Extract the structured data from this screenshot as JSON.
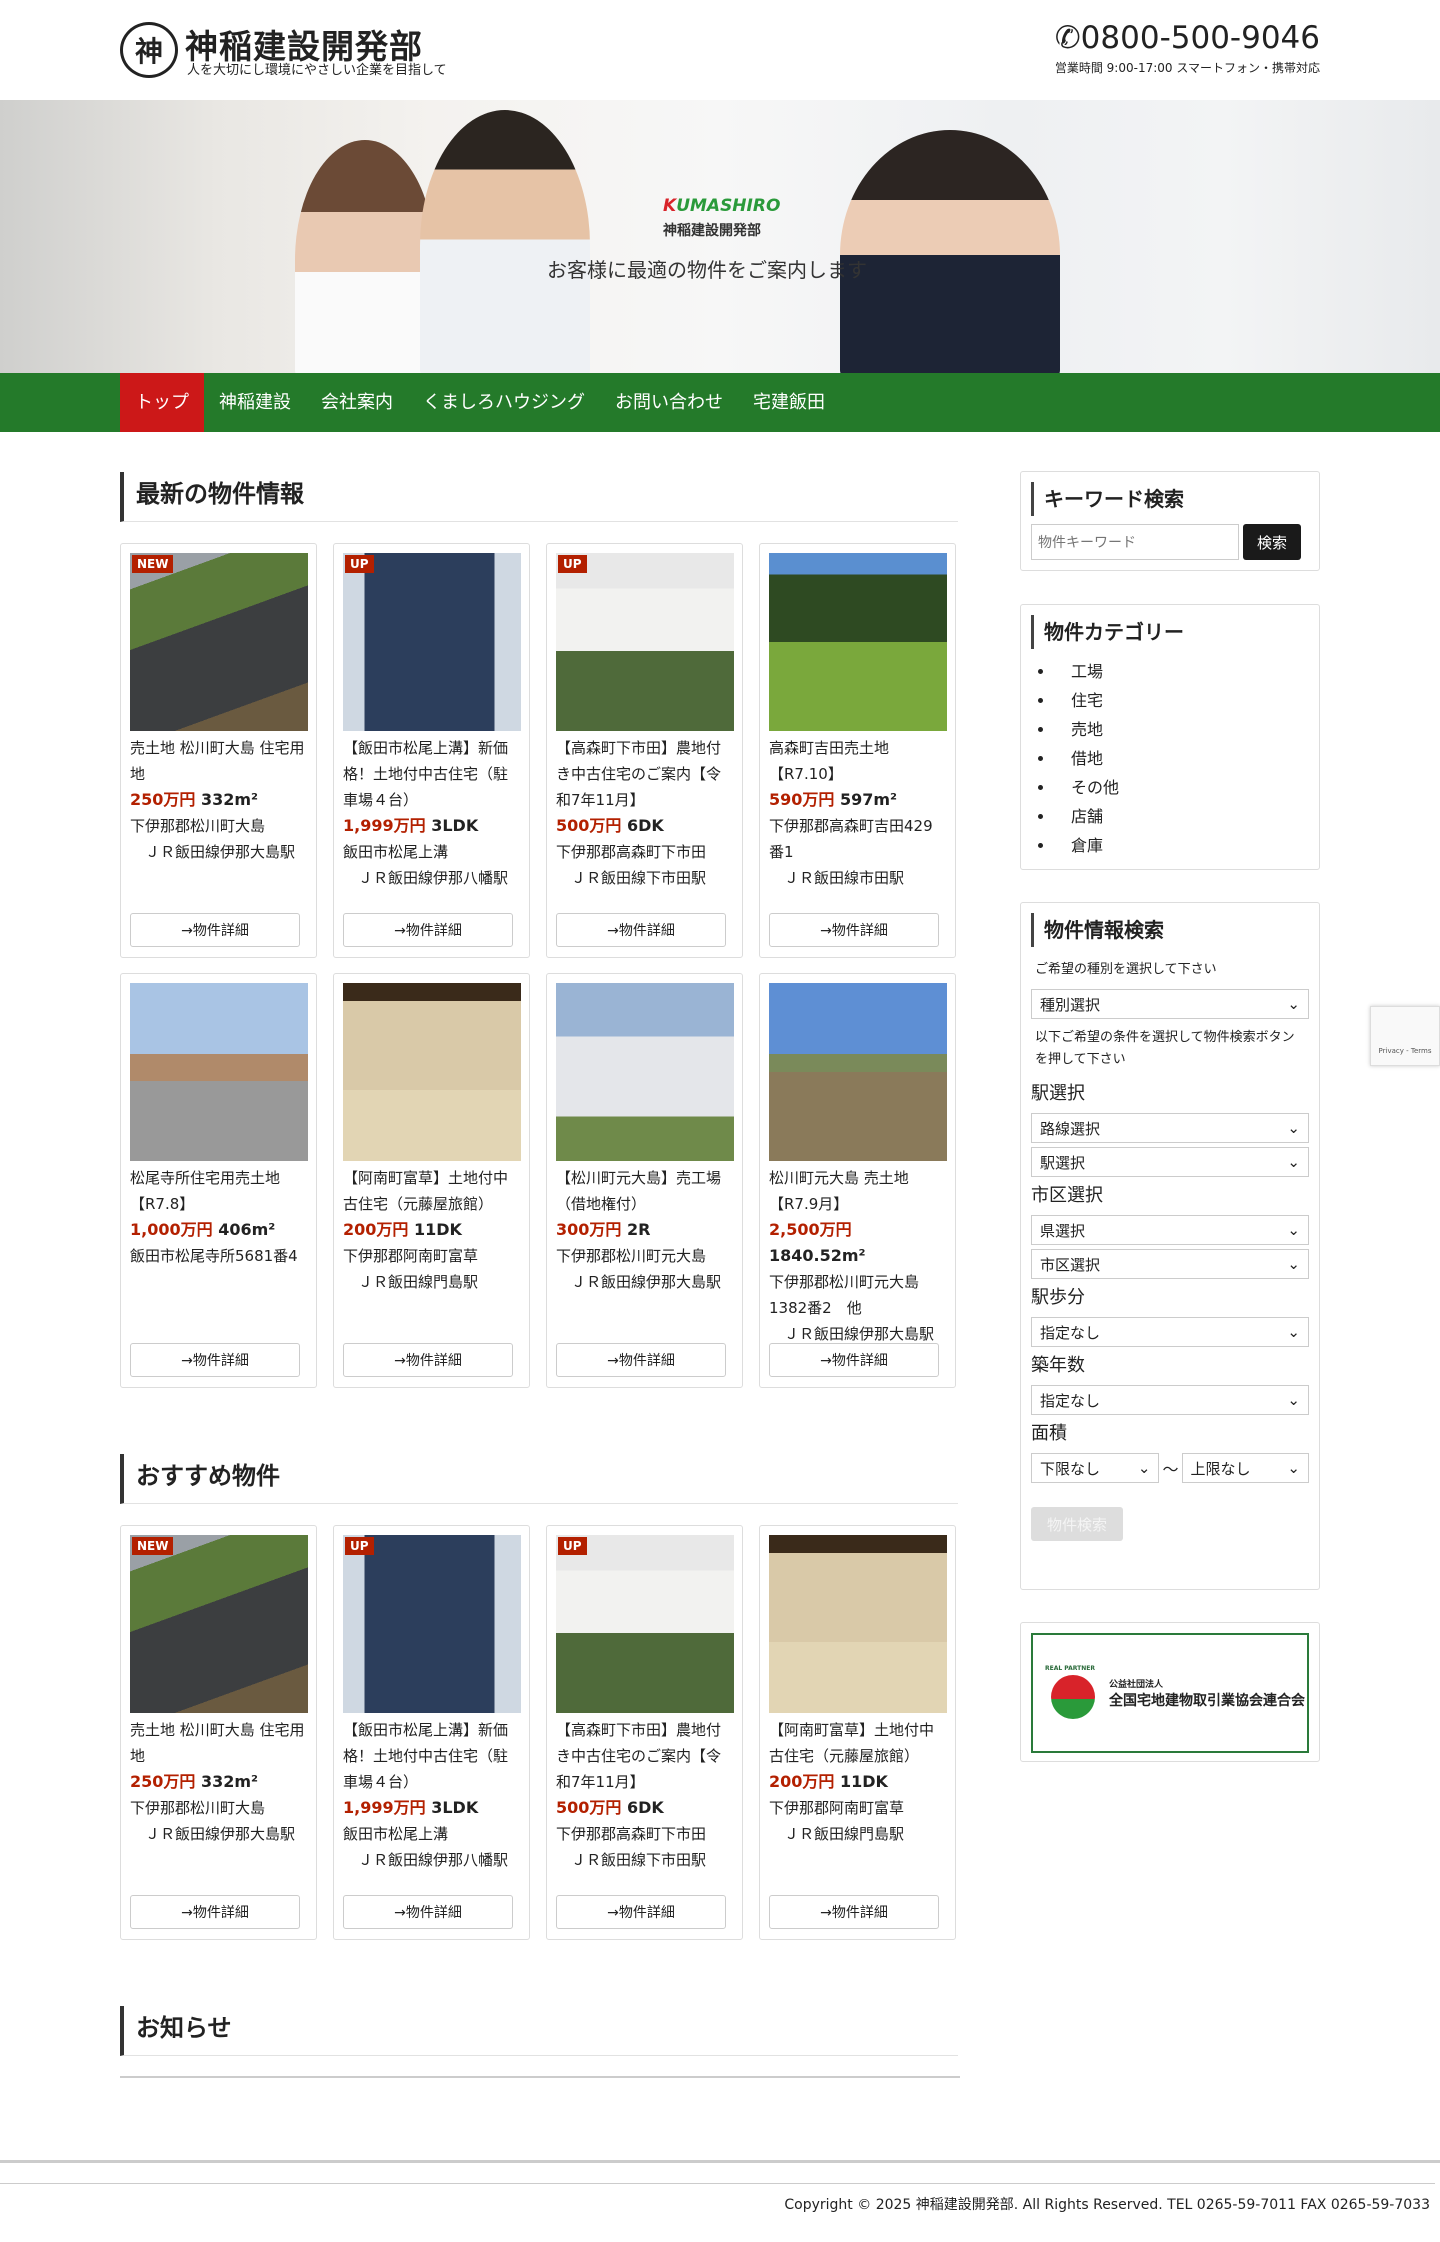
{
  "header": {
    "logo_char": "神",
    "title": "神稲建設開発部",
    "tagline": "人を大切にし環境にやさしい企業を目指して",
    "phone": "0800-500-9046",
    "hours": "営業時間 9:00-17:00 スマートフォン・携帯対応"
  },
  "hero": {
    "brand_k": "K",
    "brand_rest": "UMASHIRO",
    "sub": "神稲建設開発部",
    "copy": "お客様に最適の物件をご案内します"
  },
  "nav": [
    "トップ",
    "神稲建設",
    "会社案内",
    "くましろハウジング",
    "お問い合わせ",
    "宅建飯田"
  ],
  "sections": {
    "latest": "最新の物件情報",
    "recommended": "おすすめ物件",
    "news": "お知らせ"
  },
  "detail_label": "→物件詳細",
  "latest": [
    {
      "badge": "NEW",
      "image": "land-garden",
      "title": "売土地 松川町大島 住宅用地",
      "price": "250万円",
      "spec": "332m²",
      "address": "下伊那郡松川町大島",
      "station": "ＪＲ飯田線伊那大島駅"
    },
    {
      "badge": "UP",
      "image": "blue-house",
      "title": "【飯田市松尾上溝】新価格！土地付中古住宅（駐車場４台）",
      "price": "1,999万円",
      "spec": "3LDK",
      "address": "飯田市松尾上溝",
      "station": "ＪＲ飯田線伊那八幡駅"
    },
    {
      "badge": "UP",
      "image": "white-house",
      "title": "【高森町下市田】農地付き中古住宅のご案内【令和7年11月】",
      "price": "500万円",
      "spec": "6DK",
      "address": "下伊那郡高森町下市田",
      "station": "ＪＲ飯田線下市田駅"
    },
    {
      "badge": "",
      "image": "grass-field",
      "title": "高森町吉田売土地【R7.10】",
      "price": "590万円",
      "spec": "597m²",
      "address": "下伊那郡高森町吉田429番1",
      "station": "ＪＲ飯田線市田駅"
    },
    {
      "badge": "",
      "image": "street",
      "title": "松尾寺所住宅用売土地【R7.8】",
      "price": "1,000万円",
      "spec": "406m²",
      "address": "飯田市松尾寺所5681番4",
      "station": ""
    },
    {
      "badge": "",
      "image": "tatami-room",
      "title": "【阿南町富草】土地付中古住宅（元藤屋旅館）",
      "price": "200万円",
      "spec": "11DK",
      "address": "下伊那郡阿南町富草",
      "station": "ＪＲ飯田線門島駅"
    },
    {
      "badge": "",
      "image": "factory",
      "title": "【松川町元大島】売工場（借地権付）",
      "price": "300万円",
      "spec": "2R",
      "address": "下伊那郡松川町元大島",
      "station": "ＪＲ飯田線伊那大島駅"
    },
    {
      "badge": "",
      "image": "field-sky",
      "title": "松川町元大島 売土地【R7.9月】",
      "price": "2,500万円",
      "spec": "1840.52m²",
      "address": "下伊那郡松川町元大島1382番2　他",
      "station": "ＪＲ飯田線伊那大島駅"
    }
  ],
  "recommended": [
    {
      "badge": "NEW",
      "image": "land-garden",
      "title": "売土地 松川町大島 住宅用地",
      "price": "250万円",
      "spec": "332m²",
      "address": "下伊那郡松川町大島",
      "station": "ＪＲ飯田線伊那大島駅"
    },
    {
      "badge": "UP",
      "image": "blue-house",
      "title": "【飯田市松尾上溝】新価格！土地付中古住宅（駐車場４台）",
      "price": "1,999万円",
      "spec": "3LDK",
      "address": "飯田市松尾上溝",
      "station": "ＪＲ飯田線伊那八幡駅"
    },
    {
      "badge": "UP",
      "image": "white-house",
      "title": "【高森町下市田】農地付き中古住宅のご案内【令和7年11月】",
      "price": "500万円",
      "spec": "6DK",
      "address": "下伊那郡高森町下市田",
      "station": "ＪＲ飯田線下市田駅"
    },
    {
      "badge": "",
      "image": "tatami-room",
      "title": "【阿南町富草】土地付中古住宅（元藤屋旅館）",
      "price": "200万円",
      "spec": "11DK",
      "address": "下伊那郡阿南町富草",
      "station": "ＪＲ飯田線門島駅"
    }
  ],
  "sidebar": {
    "keyword": {
      "title": "キーワード検索",
      "placeholder": "物件キーワード",
      "button": "検索"
    },
    "category": {
      "title": "物件カテゴリー",
      "items": [
        "工場",
        "住宅",
        "売地",
        "借地",
        "その他",
        "店舗",
        "倉庫"
      ]
    },
    "search": {
      "title": "物件情報検索",
      "note1": "ご希望の種別を選択して下さい",
      "type_select": "種別選択",
      "note2": "以下ご希望の条件を選択して物件検索ボタンを押して下さい",
      "station_label": "駅選択",
      "line_select": "路線選択",
      "station_select": "駅選択",
      "city_label": "市区選択",
      "pref_select": "県選択",
      "city_select": "市区選択",
      "walk_label": "駅歩分",
      "walk_select": "指定なし",
      "age_label": "築年数",
      "age_select": "指定なし",
      "area_label": "面積",
      "area_min": "下限なし",
      "tilde": "〜",
      "area_max": "上限なし",
      "button": "物件検索"
    },
    "banner": {
      "small": "公益社団法人",
      "name": "全国宅地建物取引業協会連合会",
      "mark": "REAL PARTNER"
    }
  },
  "recaptcha": "Privacy - Terms",
  "footer": {
    "copyright": "Copyright © 2025 神稲建設開発部. All Rights Reserved. TEL 0265-59-7011 FAX 0265-59-7033"
  }
}
